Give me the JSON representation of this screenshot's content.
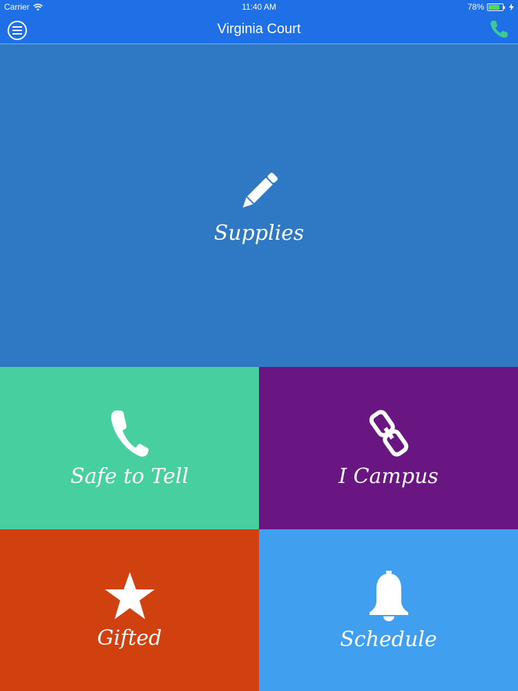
{
  "status_bar": {
    "carrier": "Carrier",
    "time": "11:40 AM",
    "battery_percent": "78%",
    "battery_level": 0.78
  },
  "nav": {
    "title": "Virginia Court",
    "menu_icon": "menu-icon",
    "phone_icon": "phone-icon"
  },
  "tiles": [
    {
      "label": "Supplies",
      "icon": "pencil-icon",
      "color": "#2f78c4"
    },
    {
      "label": "Safe to Tell",
      "icon": "phone-icon",
      "color": "#47cfa0"
    },
    {
      "label": "I Campus",
      "icon": "link-icon",
      "color": "#6a1682"
    },
    {
      "label": "Gifted",
      "icon": "star-icon",
      "color": "#d1400f"
    },
    {
      "label": "Schedule",
      "icon": "bell-icon",
      "color": "#419ff0"
    }
  ],
  "colors": {
    "nav_bar": "#1f6fe6",
    "phone_accent": "#3cc99a"
  }
}
